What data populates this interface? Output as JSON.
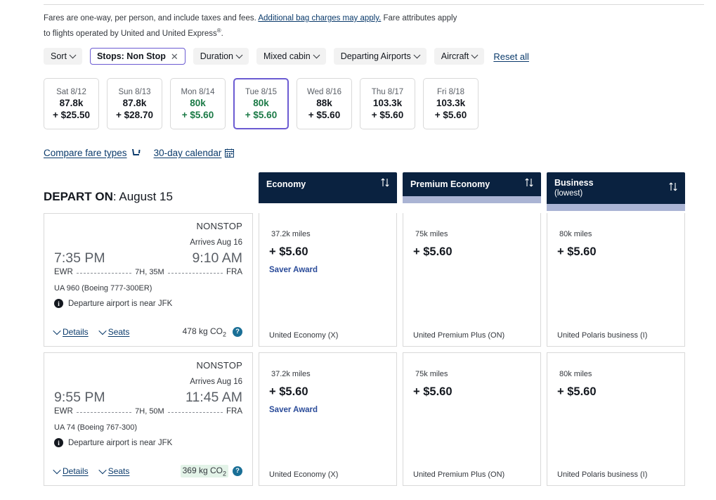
{
  "disclaimer": {
    "before_link": "Fares are one-way, per person, and include taxes and fees. ",
    "link": "Additional bag charges may apply.",
    "after_link": " Fare attributes apply to flights operated by United and United Express",
    "registered": "®",
    "period": "."
  },
  "filters": {
    "items": [
      {
        "label": "Sort",
        "type": "dropdown",
        "active": false
      },
      {
        "label": "Stops: Non Stop",
        "type": "removable",
        "active": true
      },
      {
        "label": "Duration",
        "type": "dropdown",
        "active": false
      },
      {
        "label": "Mixed cabin",
        "type": "dropdown",
        "active": false
      },
      {
        "label": "Departing Airports",
        "type": "dropdown",
        "active": false
      },
      {
        "label": "Aircraft",
        "type": "dropdown",
        "active": false
      }
    ],
    "reset_label": "Reset all"
  },
  "date_strip": [
    {
      "day": "Sat 8/12",
      "miles": "87.8k",
      "cash": "+ $25.50",
      "cheap": false,
      "selected": false
    },
    {
      "day": "Sun 8/13",
      "miles": "87.8k",
      "cash": "+ $28.70",
      "cheap": false,
      "selected": false
    },
    {
      "day": "Mon 8/14",
      "miles": "80k",
      "cash": "+ $5.60",
      "cheap": true,
      "selected": false
    },
    {
      "day": "Tue 8/15",
      "miles": "80k",
      "cash": "+ $5.60",
      "cheap": true,
      "selected": true
    },
    {
      "day": "Wed 8/16",
      "miles": "88k",
      "cash": "+ $5.60",
      "cheap": false,
      "selected": false
    },
    {
      "day": "Thu 8/17",
      "miles": "103.3k",
      "cash": "+ $5.60",
      "cheap": false,
      "selected": false
    },
    {
      "day": "Fri 8/18",
      "miles": "103.3k",
      "cash": "+ $5.60",
      "cheap": false,
      "selected": false
    }
  ],
  "links": {
    "compare_fare_types": "Compare fare types",
    "calendar": "30-day calendar"
  },
  "depart_on": {
    "prefix": "DEPART ON",
    "separator": ": ",
    "date": "August 15"
  },
  "columns": [
    {
      "title": "Economy",
      "sub": "",
      "accent": false
    },
    {
      "title": "Premium Economy",
      "sub": "",
      "accent": true
    },
    {
      "title": "Business",
      "sub": "(lowest)",
      "accent": true
    }
  ],
  "flights": [
    {
      "nonstop": "NONSTOP",
      "arrives": "Arrives Aug 16",
      "depart_time": "7:35 PM",
      "arrive_time": "9:10 AM",
      "origin": "EWR",
      "destination": "FRA",
      "duration": "7H, 35M",
      "equipment": "UA 960 (Boeing 777-300ER)",
      "note": "Departure airport is near JFK",
      "details_label": "Details",
      "seats_label": "Seats",
      "co2": "478 kg CO",
      "co2_sub": "2",
      "co2_green": false,
      "fares": [
        {
          "miles": "37.2k",
          "miles_unit": "miles",
          "cash": "+ $5.60",
          "saver": "Saver Award",
          "fare_class": "United Economy (X)"
        },
        {
          "miles": "75k",
          "miles_unit": "miles",
          "cash": "+ $5.60",
          "saver": "",
          "fare_class": "United Premium Plus (ON)"
        },
        {
          "miles": "80k",
          "miles_unit": "miles",
          "cash": "+ $5.60",
          "saver": "",
          "fare_class": "United Polaris business (I)"
        }
      ]
    },
    {
      "nonstop": "NONSTOP",
      "arrives": "Arrives Aug 16",
      "depart_time": "9:55 PM",
      "arrive_time": "11:45 AM",
      "origin": "EWR",
      "destination": "FRA",
      "duration": "7H, 50M",
      "equipment": "UA 74 (Boeing 767-300)",
      "note": "Departure airport is near JFK",
      "details_label": "Details",
      "seats_label": "Seats",
      "co2": "369 kg CO",
      "co2_sub": "2",
      "co2_green": true,
      "fares": [
        {
          "miles": "37.2k",
          "miles_unit": "miles",
          "cash": "+ $5.60",
          "saver": "Saver Award",
          "fare_class": "United Economy (X)"
        },
        {
          "miles": "75k",
          "miles_unit": "miles",
          "cash": "+ $5.60",
          "saver": "",
          "fare_class": "United Premium Plus (ON)"
        },
        {
          "miles": "80k",
          "miles_unit": "miles",
          "cash": "+ $5.60",
          "saver": "",
          "fare_class": "United Polaris business (I)"
        }
      ]
    }
  ],
  "colors": {
    "navy": "#0a2240",
    "accent_band": "#aab4d4",
    "selected_border": "#6b5bd2",
    "cheap_green": "#1b7a46",
    "link_blue": "#0a3a6b",
    "saver_blue": "#2a4b99"
  }
}
